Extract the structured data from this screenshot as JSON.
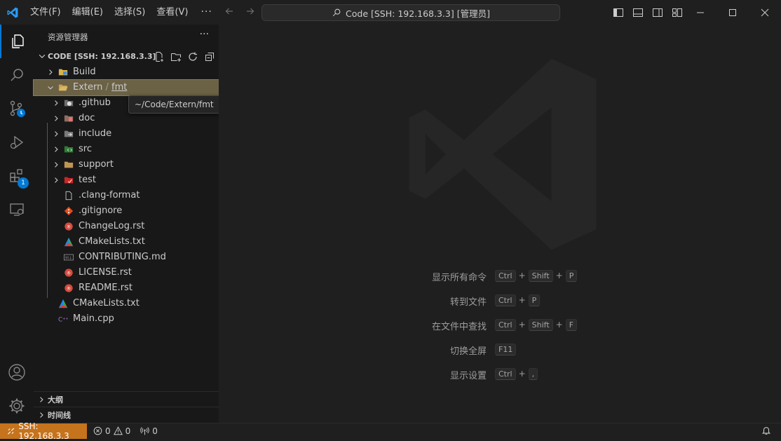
{
  "colors": {
    "accent": "#0078d4",
    "remote_bg": "#c5731c",
    "selection_bg": "#6b6145"
  },
  "titlebar": {
    "menus": [
      "文件(F)",
      "编辑(E)",
      "选择(S)",
      "查看(V)"
    ],
    "more": "···",
    "command_center": "Code [SSH: 192.168.3.3] [管理员]"
  },
  "activitybar": {
    "extensions_badge": "1"
  },
  "sidebar": {
    "title": "资源管理器",
    "more": "···",
    "root_label": "CODE [SSH: 192.168.3.3]",
    "tree": [
      {
        "label": "Build",
        "icon": "folder-build-icon",
        "kind": "folder",
        "expanded": false,
        "depth": 0
      },
      {
        "label_a": "Extern",
        "label_sep": "/",
        "label_b": "fmt",
        "icon": "folder-open-icon",
        "kind": "folder",
        "expanded": true,
        "depth": 0,
        "selected": true
      },
      {
        "label": ".github",
        "icon": "folder-github-icon",
        "kind": "folder",
        "depth": 1
      },
      {
        "label": "doc",
        "icon": "folder-doc-icon",
        "kind": "folder",
        "depth": 1
      },
      {
        "label": "include",
        "icon": "folder-include-icon",
        "kind": "folder",
        "depth": 1
      },
      {
        "label": "src",
        "icon": "folder-src-icon",
        "kind": "folder",
        "depth": 1
      },
      {
        "label": "support",
        "icon": "folder-icon",
        "kind": "folder",
        "depth": 1
      },
      {
        "label": "test",
        "icon": "folder-test-icon",
        "kind": "folder",
        "depth": 1
      },
      {
        "label": ".clang-format",
        "icon": "file-icon",
        "kind": "file",
        "depth": 1
      },
      {
        "label": ".gitignore",
        "icon": "git-icon",
        "kind": "file",
        "depth": 1
      },
      {
        "label": "ChangeLog.rst",
        "icon": "rst-icon",
        "kind": "file",
        "depth": 1
      },
      {
        "label": "CMakeLists.txt",
        "icon": "cmake-icon",
        "kind": "file",
        "depth": 1
      },
      {
        "label": "CONTRIBUTING.md",
        "icon": "markdown-icon",
        "kind": "file",
        "depth": 1
      },
      {
        "label": "LICENSE.rst",
        "icon": "rst-icon",
        "kind": "file",
        "depth": 1
      },
      {
        "label": "README.rst",
        "icon": "rst-icon",
        "kind": "file",
        "depth": 1
      },
      {
        "label": "CMakeLists.txt",
        "icon": "cmake-icon",
        "kind": "file",
        "depth": 0
      },
      {
        "label": "Main.cpp",
        "icon": "cpp-icon",
        "kind": "file",
        "depth": 0
      }
    ],
    "tooltip": "~/Code/Extern/fmt",
    "panels": [
      "大纲",
      "时间线"
    ]
  },
  "editor": {
    "shortcuts": [
      {
        "label": "显示所有命令",
        "keys": [
          "Ctrl",
          "Shift",
          "P"
        ]
      },
      {
        "label": "转到文件",
        "keys": [
          "Ctrl",
          "P"
        ]
      },
      {
        "label": "在文件中查找",
        "keys": [
          "Ctrl",
          "Shift",
          "F"
        ]
      },
      {
        "label": "切换全屏",
        "keys": [
          "F11"
        ]
      },
      {
        "label": "显示设置",
        "keys": [
          "Ctrl",
          ","
        ]
      }
    ]
  },
  "statusbar": {
    "remote": "SSH: 192.168.3.3",
    "errors": "0",
    "warnings": "0",
    "ports": "0"
  }
}
